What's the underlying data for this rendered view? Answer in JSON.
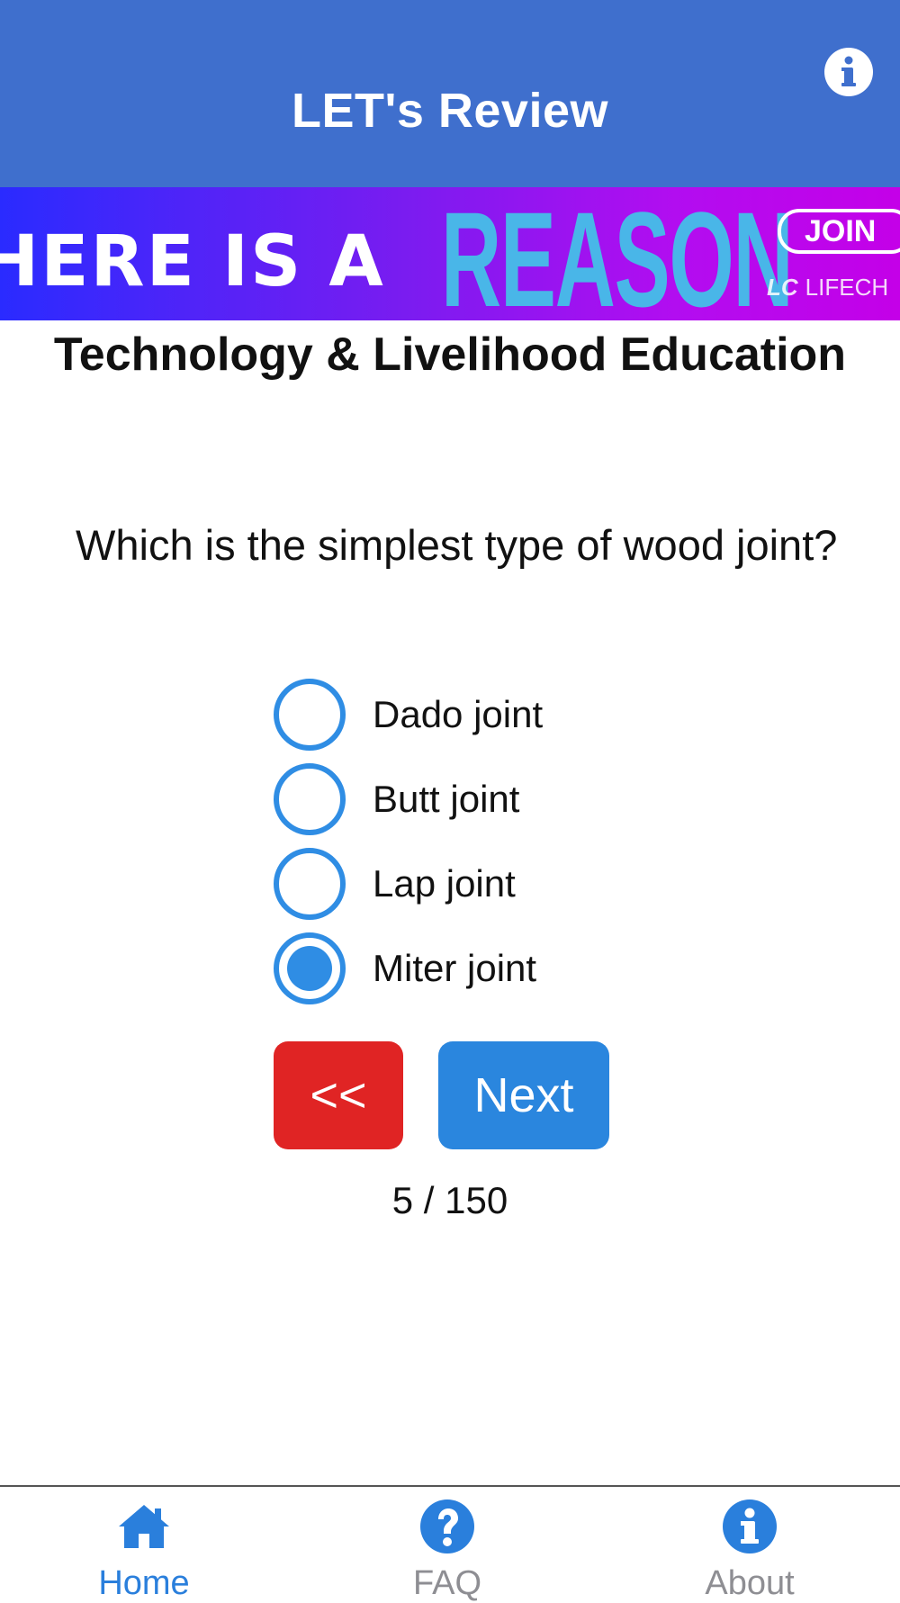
{
  "header": {
    "title": "LET's Review",
    "info_icon": "info-icon"
  },
  "banner": {
    "left_text": "HERE IS A",
    "highlight_text": "REASON",
    "join_label": "JOIN",
    "brand_mark": "LC",
    "brand_text": "LIFECH"
  },
  "subject": "Technology & Livelihood Education",
  "question": "Which is the simplest type of wood joint?",
  "options": [
    {
      "label": "Dado joint",
      "selected": false
    },
    {
      "label": "Butt joint",
      "selected": false
    },
    {
      "label": "Lap joint",
      "selected": false
    },
    {
      "label": "Miter joint",
      "selected": true
    }
  ],
  "buttons": {
    "back_label": "<<",
    "next_label": "Next"
  },
  "progress": "5 / 150",
  "tabs": [
    {
      "label": "Home",
      "icon": "home-icon",
      "active": true
    },
    {
      "label": "FAQ",
      "icon": "question-icon",
      "active": false
    },
    {
      "label": "About",
      "icon": "info-icon",
      "active": false
    }
  ],
  "colors": {
    "header": "#3f6fcd",
    "accent": "#2f8de4",
    "back_button": "#e02424",
    "next_button": "#2a86de",
    "tab_inactive": "#8e8e93"
  }
}
